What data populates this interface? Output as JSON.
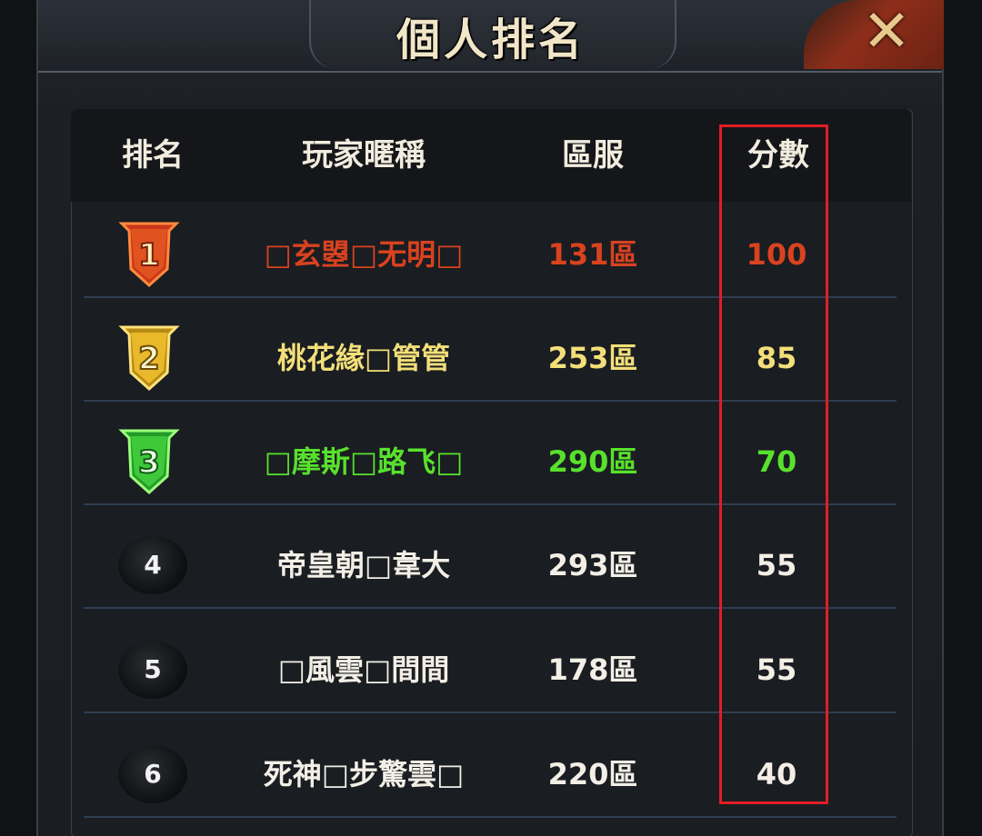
{
  "window": {
    "title": "個人排名",
    "close_label": "✕"
  },
  "table": {
    "headers": {
      "rank": "排名",
      "player": "玩家暱稱",
      "server": "區服",
      "score": "分數"
    },
    "rows": [
      {
        "rank": "1",
        "player": "□玄曌□无明□",
        "server": "131區",
        "score": "100",
        "color": "#d9421f"
      },
      {
        "rank": "2",
        "player": "桃花緣□管管",
        "server": "253區",
        "score": "85",
        "color": "#f3df79"
      },
      {
        "rank": "3",
        "player": "□摩斯□路飞□",
        "server": "290區",
        "score": "70",
        "color": "#58e12c"
      },
      {
        "rank": "4",
        "player": "帝皇朝□韋大",
        "server": "293區",
        "score": "55",
        "color": "#f3efe6"
      },
      {
        "rank": "5",
        "player": "□風雲□間間",
        "server": "178區",
        "score": "55",
        "color": "#f3efe6"
      },
      {
        "rank": "6",
        "player": "死神□步驚雲□",
        "server": "220區",
        "score": "40",
        "color": "#f3efe6"
      }
    ]
  },
  "colors": {
    "highlight_border": "#e21d24",
    "gold_badge": "#e9b82b",
    "red_badge": "#e0521f",
    "green_badge": "#3ec83a"
  }
}
